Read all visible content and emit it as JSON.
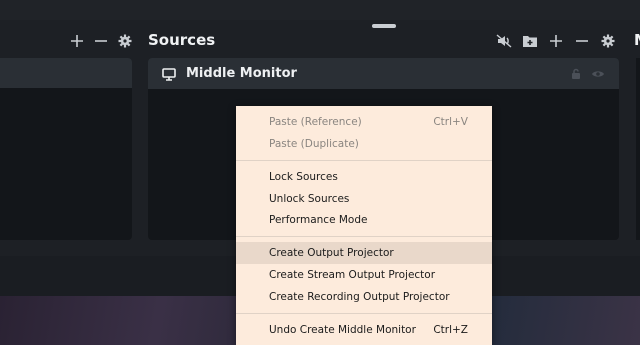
{
  "sources_dock": {
    "title": "Sources",
    "next_dock_title_fragment": "M",
    "source_items": [
      {
        "name": "Middle Monitor"
      }
    ]
  },
  "context_menu": {
    "items": [
      {
        "label": "Paste (Reference)",
        "shortcut": "Ctrl+V",
        "disabled": true
      },
      {
        "label": "Paste (Duplicate)",
        "shortcut": "",
        "disabled": true
      },
      {
        "label": "Lock Sources",
        "shortcut": ""
      },
      {
        "label": "Unlock Sources",
        "shortcut": ""
      },
      {
        "label": "Performance Mode",
        "shortcut": ""
      },
      {
        "label": "Create Output Projector",
        "shortcut": "",
        "hovered": true
      },
      {
        "label": "Create Stream Output Projector",
        "shortcut": ""
      },
      {
        "label": "Create Recording Output Projector",
        "shortcut": ""
      },
      {
        "label": "Undo Create Middle Monitor",
        "shortcut": "Ctrl+Z"
      }
    ]
  },
  "icons": {
    "left_dock_tools": [
      "plus-icon",
      "minus-icon",
      "gear-icon"
    ],
    "sources_tools": [
      "audio-icon",
      "folder-add-icon",
      "plus-icon",
      "minus-icon",
      "gear-icon"
    ],
    "source_row": [
      "monitor-icon",
      "lock-icon",
      "eye-icon"
    ]
  },
  "colors": {
    "dock_background": "#1d2025",
    "panel_background": "#13161a",
    "row_background": "#2a2f35",
    "menu_background": "#fdebdc",
    "menu_hover": "#e9d8ca"
  }
}
